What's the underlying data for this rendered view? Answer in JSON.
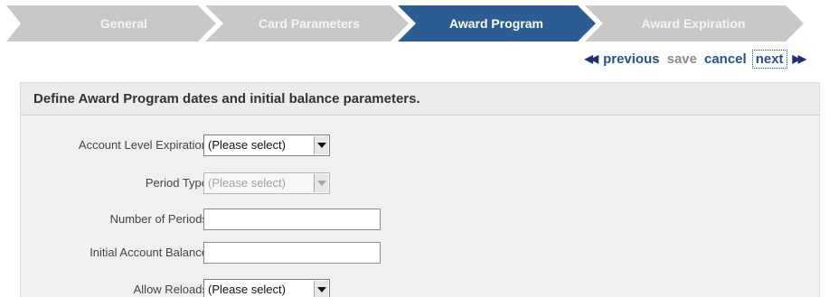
{
  "wizard": {
    "steps": [
      {
        "label": "General",
        "active": false
      },
      {
        "label": "Card Parameters",
        "active": false
      },
      {
        "label": "Award Program",
        "active": true
      },
      {
        "label": "Award Expiration",
        "active": false
      }
    ],
    "colors": {
      "inactive": "#c8c8c8",
      "active": "#2b5d92",
      "text": "#ffffff"
    }
  },
  "nav": {
    "previous_icon": "rewind-icon",
    "previous_label": "previous",
    "save_label": "save",
    "cancel_label": "cancel",
    "next_label": "next",
    "next_icon": "fast-forward-icon"
  },
  "panel": {
    "title": "Define Award Program dates and initial balance parameters.",
    "fields": {
      "account_level_expiration": {
        "label": "Account Level Expiration",
        "value": "(Please select)"
      },
      "period_type": {
        "label": "Period Type",
        "value": "(Please select)",
        "disabled": true
      },
      "number_of_periods": {
        "label": "Number of Periods",
        "value": ""
      },
      "initial_account_balance": {
        "label": "Initial Account Balance",
        "value": ""
      },
      "allow_reloads": {
        "label": "Allow Reloads",
        "value": "(Please select)"
      }
    }
  }
}
